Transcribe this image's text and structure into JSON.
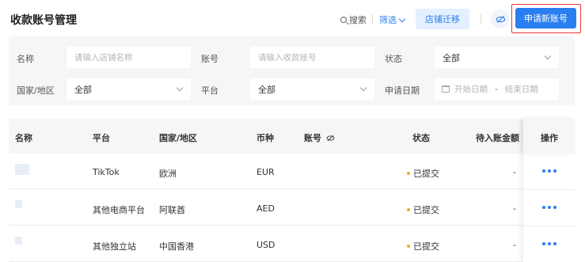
{
  "header": {
    "title": "收款账号管理",
    "search_label": "搜索",
    "filter_label": "筛选",
    "migrate_label": "店铺迁移",
    "apply_label": "申请新账号"
  },
  "filters": {
    "name_label": "名称",
    "name_placeholder": "请输入店铺名称",
    "account_label": "账号",
    "account_placeholder": "请输入收款账号",
    "status_label": "状态",
    "status_value": "全部",
    "country_label": "国家/地区",
    "country_value": "全部",
    "platform_label": "平台",
    "platform_value": "全部",
    "date_label": "申请日期",
    "date_start_placeholder": "开始日期",
    "date_separator": "-",
    "date_end_placeholder": "结束日期"
  },
  "table": {
    "columns": {
      "name": "名称",
      "platform": "平台",
      "country": "国家/地区",
      "currency": "币种",
      "account": "账号",
      "status": "状态",
      "pending": "待入账金额",
      "ops": "操作"
    },
    "rows": [
      {
        "platform": "TikTok",
        "country": "欧洲",
        "currency": "EUR",
        "status": "已提交",
        "pending": "-"
      },
      {
        "platform": "其他电商平台",
        "country": "阿联酋",
        "currency": "AED",
        "status": "已提交",
        "pending": "-"
      },
      {
        "platform": "其他独立站",
        "country": "中国香港",
        "currency": "USD",
        "status": "已提交",
        "pending": "-"
      }
    ]
  },
  "colors": {
    "accent": "#2a7ff0",
    "highlight": "#e53935",
    "status_dot": "#f5a623"
  }
}
